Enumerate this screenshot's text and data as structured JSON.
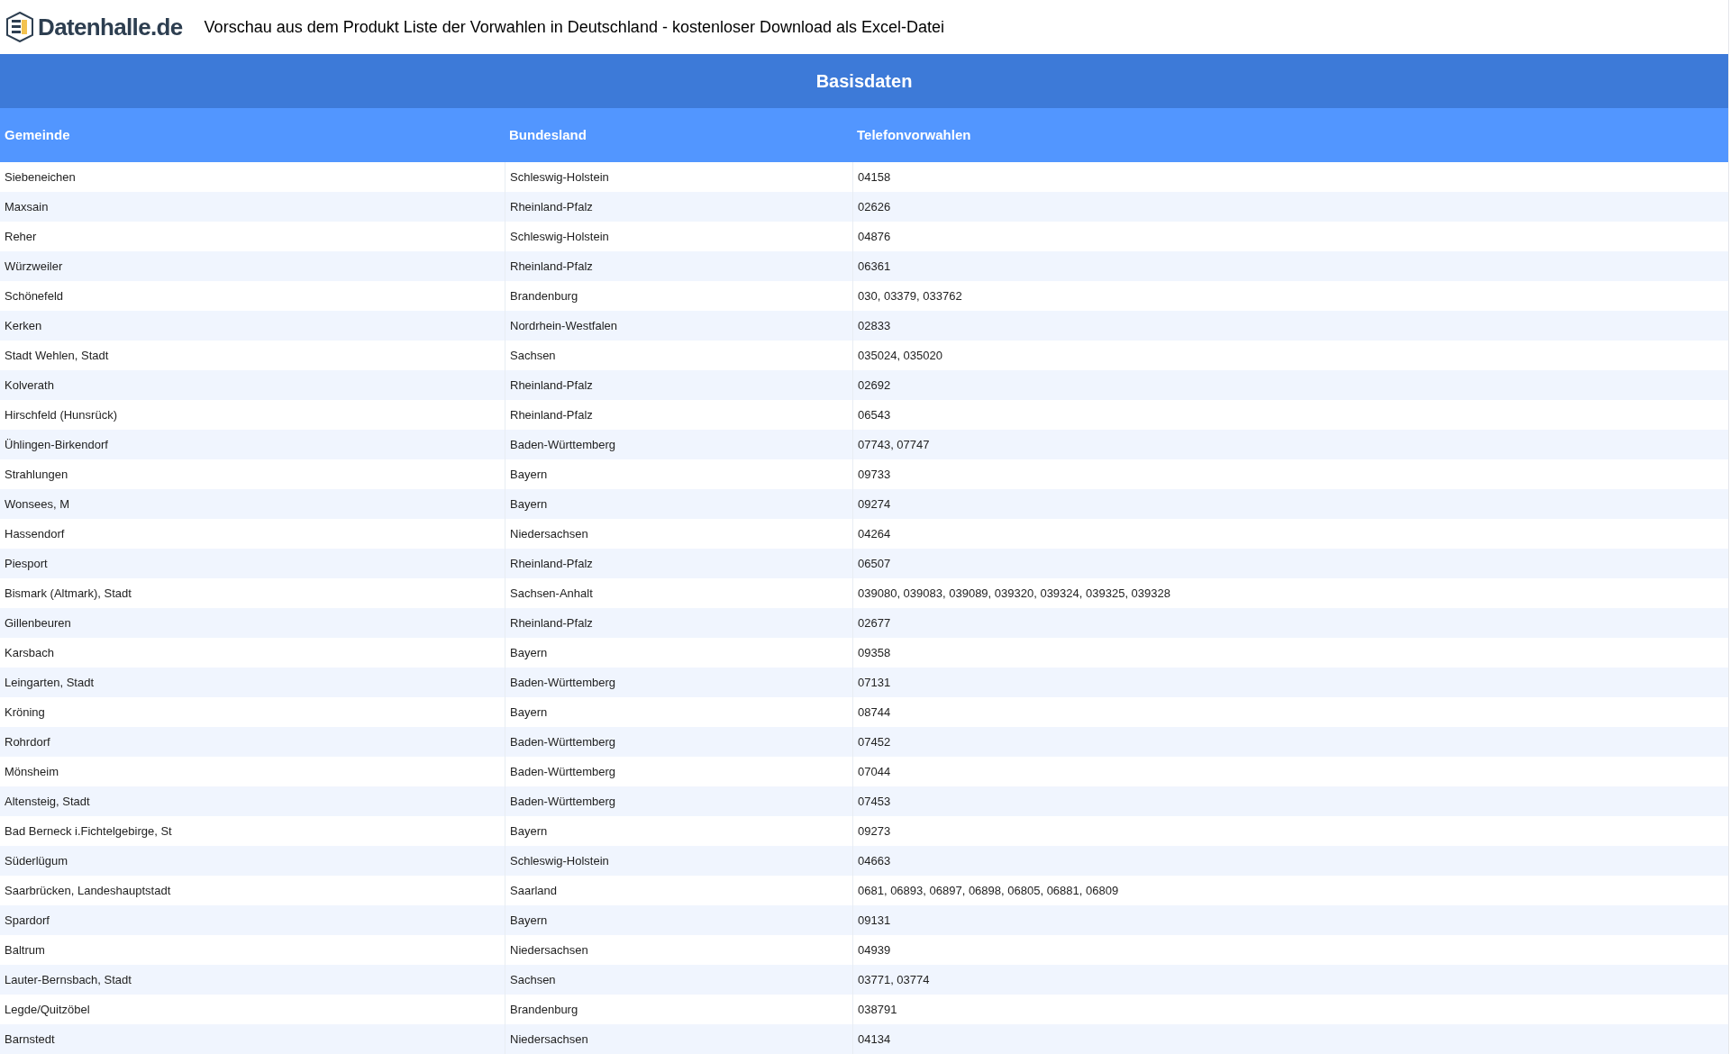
{
  "header": {
    "logo_text": "Datenhalle.de",
    "title": "Vorschau aus dem Produkt Liste der Vorwahlen in Deutschland - kostenloser Download als Excel-Datei"
  },
  "table": {
    "caption": "Basisdaten",
    "columns": [
      "Gemeinde",
      "Bundesland",
      "Telefonvorwahlen"
    ],
    "rows": [
      [
        "Siebeneichen",
        "Schleswig-Holstein",
        "04158"
      ],
      [
        "Maxsain",
        "Rheinland-Pfalz",
        "02626"
      ],
      [
        "Reher",
        "Schleswig-Holstein",
        "04876"
      ],
      [
        "Würzweiler",
        "Rheinland-Pfalz",
        "06361"
      ],
      [
        "Schönefeld",
        "Brandenburg",
        "030, 03379, 033762"
      ],
      [
        "Kerken",
        "Nordrhein-Westfalen",
        "02833"
      ],
      [
        "Stadt Wehlen, Stadt",
        "Sachsen",
        "035024, 035020"
      ],
      [
        "Kolverath",
        "Rheinland-Pfalz",
        "02692"
      ],
      [
        "Hirschfeld (Hunsrück)",
        "Rheinland-Pfalz",
        "06543"
      ],
      [
        "Ühlingen-Birkendorf",
        "Baden-Württemberg",
        "07743, 07747"
      ],
      [
        "Strahlungen",
        "Bayern",
        "09733"
      ],
      [
        "Wonsees, M",
        "Bayern",
        "09274"
      ],
      [
        "Hassendorf",
        "Niedersachsen",
        "04264"
      ],
      [
        "Piesport",
        "Rheinland-Pfalz",
        "06507"
      ],
      [
        "Bismark (Altmark), Stadt",
        "Sachsen-Anhalt",
        "039080, 039083, 039089, 039320, 039324, 039325, 039328"
      ],
      [
        "Gillenbeuren",
        "Rheinland-Pfalz",
        "02677"
      ],
      [
        "Karsbach",
        "Bayern",
        "09358"
      ],
      [
        "Leingarten, Stadt",
        "Baden-Württemberg",
        "07131"
      ],
      [
        "Kröning",
        "Bayern",
        "08744"
      ],
      [
        "Rohrdorf",
        "Baden-Württemberg",
        "07452"
      ],
      [
        "Mönsheim",
        "Baden-Württemberg",
        "07044"
      ],
      [
        "Altensteig, Stadt",
        "Baden-Württemberg",
        "07453"
      ],
      [
        "Bad Berneck i.Fichtelgebirge, St",
        "Bayern",
        "09273"
      ],
      [
        "Süderlügum",
        "Schleswig-Holstein",
        "04663"
      ],
      [
        "Saarbrücken, Landeshauptstadt",
        "Saarland",
        "0681, 06893, 06897, 06898, 06805, 06881, 06809"
      ],
      [
        "Spardorf",
        "Bayern",
        "09131"
      ],
      [
        "Baltrum",
        "Niedersachsen",
        "04939"
      ],
      [
        "Lauter-Bernsbach, Stadt",
        "Sachsen",
        "03771, 03774"
      ],
      [
        "Legde/Quitzöbel",
        "Brandenburg",
        "038791"
      ],
      [
        "Barnstedt",
        "Niedersachsen",
        "04134"
      ]
    ]
  }
}
